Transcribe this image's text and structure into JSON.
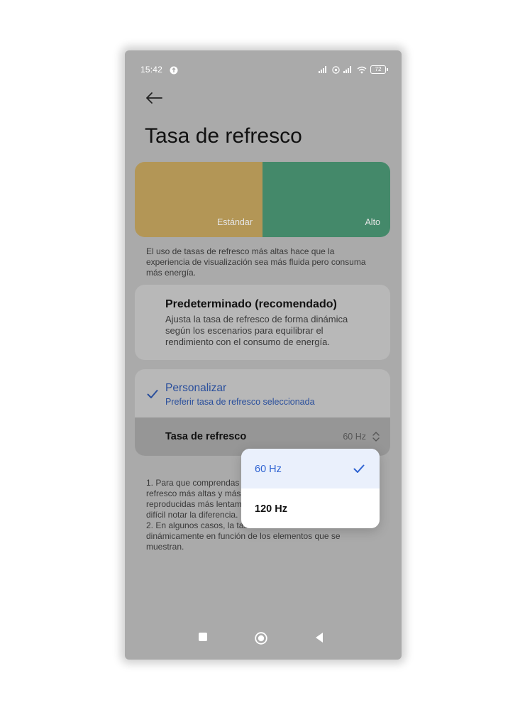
{
  "status_bar": {
    "time": "15:42",
    "battery": "72"
  },
  "header": {
    "title": "Tasa de refresco"
  },
  "preview": {
    "standard_label": "Estándar",
    "high_label": "Alto",
    "colors": {
      "standard": "#b39656",
      "high": "#44896a"
    }
  },
  "description": "El uso de tasas de refresco más altas hace que la experiencia de visualización sea más fluida pero consuma más energía.",
  "option_default": {
    "title": "Predeterminado (recomendado)",
    "subtitle": "Ajusta la tasa de refresco de forma dinámica según los escenarios para equilibrar el rendimiento con el consumo de energía."
  },
  "option_custom": {
    "title": "Personalizar",
    "subtitle": "Preferir tasa de refresco seleccionada",
    "selected": true,
    "rate_row": {
      "label": "Tasa de refresco",
      "value": "60 Hz"
    }
  },
  "notes": {
    "line1": "1. Para que comprendas mejor el efecto de las tasas de refresco más altas y más bajas, las animaciones se reproducidas más lentamente. En la práctica, será más difícil notar la diferencia.",
    "line2": "2. En algunos casos, la tasa de refresco cambiará dinámicamente en función de los elementos que se muestran."
  },
  "dropdown": {
    "options": [
      {
        "label": "60 Hz",
        "selected": true
      },
      {
        "label": "120 Hz",
        "selected": false
      }
    ],
    "accent": "#2f63d2"
  },
  "navbar": {
    "icons": [
      "recents-square-icon",
      "home-circle-icon",
      "back-triangle-icon"
    ]
  }
}
